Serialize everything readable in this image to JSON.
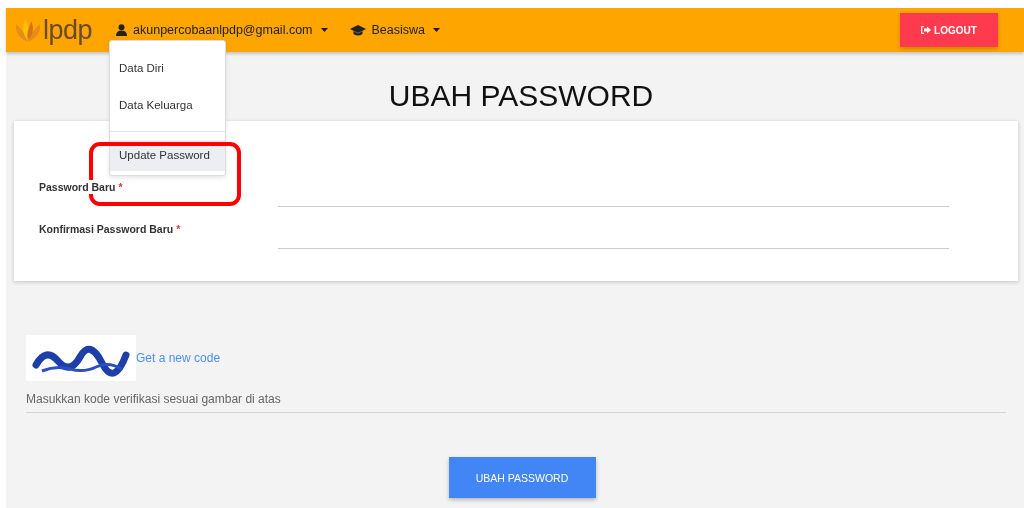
{
  "navbar": {
    "logo": "lpdp",
    "menus": [
      {
        "kind": "user",
        "label": "akunpercobaanlpdp@gmail.com",
        "dropdown": [
          [
            {
              "label": "Data Diri",
              "selected": false,
              "annotated": false
            },
            {
              "label": "Data Keluarga",
              "selected": false,
              "annotated": false
            }
          ],
          [
            {
              "label": "Update Password",
              "selected": true,
              "annotated": true
            }
          ]
        ]
      },
      {
        "kind": "graduation",
        "label": "Beasiswa"
      }
    ],
    "logout": "LOGOUT"
  },
  "title": "UBAH PASSWORD",
  "fields": [
    {
      "label": "Password Baru",
      "required_mark": "*"
    },
    {
      "label": "Konfirmasi Password Baru",
      "required_mark": "*"
    }
  ],
  "captcha": {
    "refresh_link": "Get a new code",
    "placeholder": "Masukkan kode verifikasi sesuai gambar di atas"
  },
  "submit": "UBAH PASSWORD"
}
